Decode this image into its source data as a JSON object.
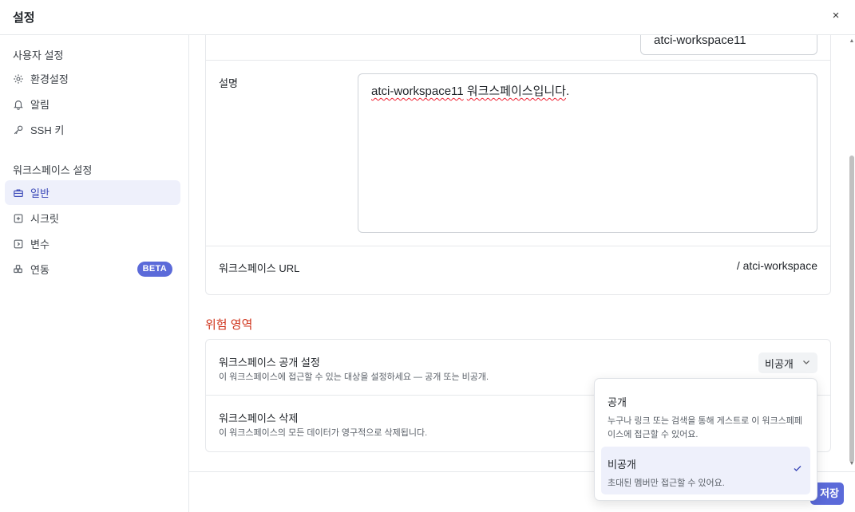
{
  "dialog": {
    "title": "설정",
    "close_label": "×"
  },
  "sidebar": {
    "user_section": "사용자 설정",
    "user_items": [
      {
        "label": "환경설정",
        "icon": "gear-icon"
      },
      {
        "label": "알림",
        "icon": "bell-icon"
      },
      {
        "label": "SSH 키",
        "icon": "key-icon"
      }
    ],
    "workspace_section": "워크스페이스 설정",
    "workspace_items": [
      {
        "label": "일반",
        "icon": "briefcase-icon",
        "active": true
      },
      {
        "label": "시크릿",
        "icon": "secret-icon"
      },
      {
        "label": "변수",
        "icon": "variable-icon"
      },
      {
        "label": "연동",
        "icon": "integration-icon",
        "badge": "BETA"
      }
    ]
  },
  "general": {
    "name_value": "atci-workspace11",
    "description_label": "설명",
    "description_word1": "atci-workspace11",
    "description_word2": "워크스페이스입니다",
    "description_end": ".",
    "url_label": "워크스페이스 URL",
    "url_value": "/ atci-workspace"
  },
  "danger_zone": {
    "title": "위험 영역",
    "visibility_label": "워크스페이스 공개 설정",
    "visibility_desc": "이 워크스페이스에 접근할 수 있는 대상을 설정하세요 — 공개 또는 비공개.",
    "visibility_selected": "비공개",
    "delete_label": "워크스페이스 삭제",
    "delete_desc": "이 워크스페이스의 모든 데이터가 영구적으로 삭제됩니다."
  },
  "visibility_options": [
    {
      "title": "공개",
      "desc_line1": "누구나 링크 또는 검색을 통해 게스트로 이 워크스페페",
      "desc_line2": "이스에 접근할 수 있어요."
    },
    {
      "title": "비공개",
      "desc_line1": "초대된 멤버만 접근할 수 있어요.",
      "selected": true
    }
  ],
  "footer": {
    "save_label": "저장"
  },
  "colors": {
    "accent": "#5b6ad9",
    "danger": "#d0341c",
    "active_bg": "#eef0fb"
  }
}
